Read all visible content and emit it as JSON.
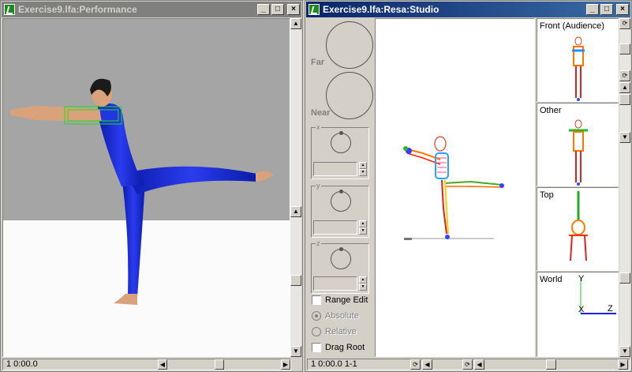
{
  "performance_window": {
    "title": "Exercise9.lfa:Performance",
    "status": "1 0:00.0"
  },
  "studio_window": {
    "title": "Exercise9.lfa:Resa:Studio",
    "status": "1 0:00.0 1-1",
    "dial_labels": {
      "far": "Far",
      "near": "Near"
    },
    "axis_groups": [
      "x",
      "y",
      "z"
    ],
    "options": {
      "range_edit": "Range Edit",
      "absolute": "Absolute",
      "relative": "Relative",
      "drag_root": "Drag Root"
    },
    "views": [
      {
        "label": "Front (Audience)"
      },
      {
        "label": "Other"
      },
      {
        "label": "Top"
      },
      {
        "label": "World"
      }
    ],
    "world_axes": {
      "y": "Y",
      "x": "X",
      "z": "Z"
    }
  },
  "window_buttons": {
    "minimize": "_",
    "maximize": "□",
    "close": "×"
  },
  "colors": {
    "active_title": "#0a246a",
    "inactive_title": "#808080",
    "figure_blue": "#1c2fd6",
    "skin": "#d9a27a"
  }
}
